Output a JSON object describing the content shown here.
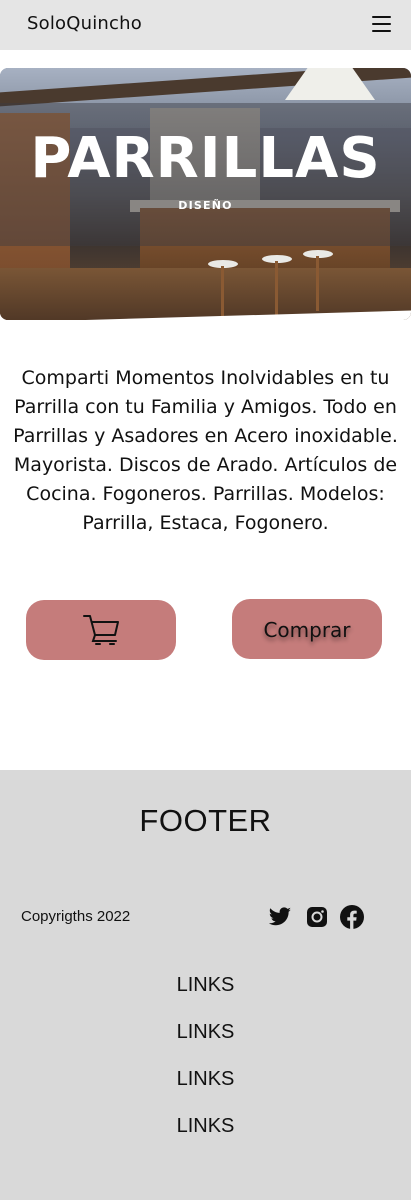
{
  "header": {
    "brand": "SoloQuincho",
    "menu_icon": "hamburger-menu-icon"
  },
  "hero": {
    "title": "PARRILLAS",
    "subtitle": "DISEÑO"
  },
  "description": "Comparti Momentos Inolvidables en tu Parrilla con tu Familia y Amigos. Todo en Parrillas y Asadores en Acero inoxidable. Mayorista. Discos de Arado. Artículos de Cocina. Fogoneros. Parrillas. Modelos: Parrilla, Estaca, Fogonero.",
  "actions": {
    "cart_icon": "shopping-cart-icon",
    "buy_label": "Comprar",
    "button_color": "#c57c7b"
  },
  "footer": {
    "title": "FOOTER",
    "copyright": "Copyrigths 2022",
    "social_icons": [
      "twitter-icon",
      "instagram-icon",
      "facebook-icon"
    ],
    "links": [
      "LINKS",
      "LINKS",
      "LINKS",
      "LINKS"
    ],
    "background": "#d9d9d9"
  }
}
